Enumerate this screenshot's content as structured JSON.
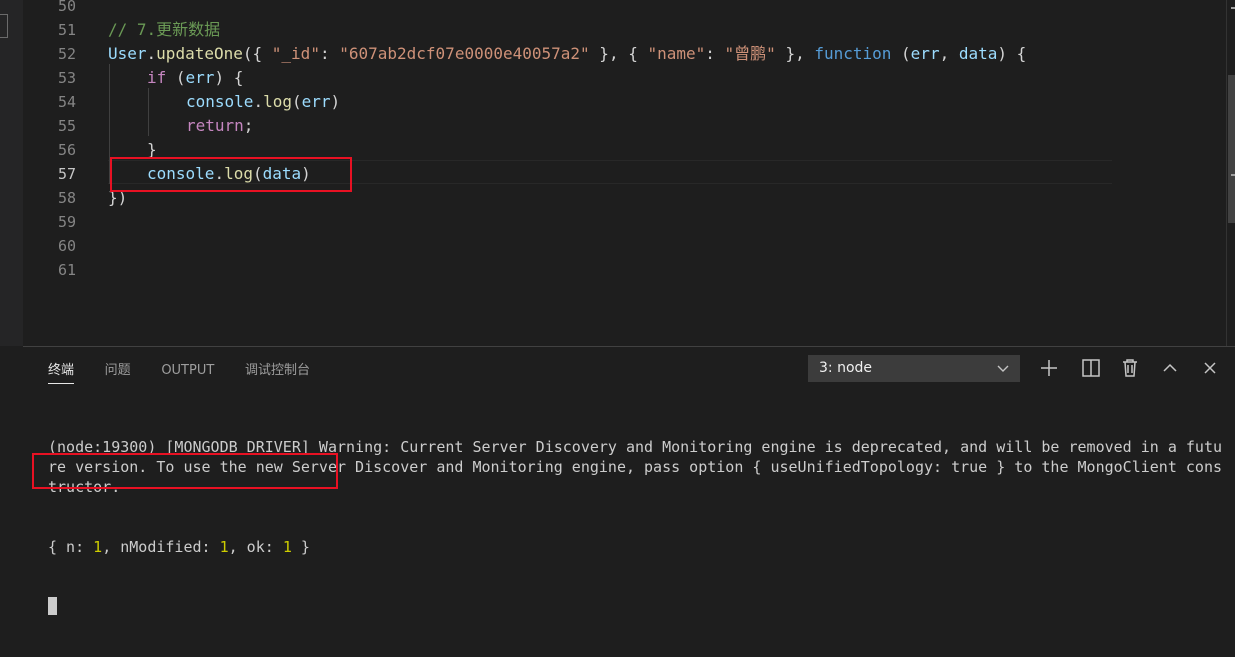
{
  "editor": {
    "lines": [
      {
        "number": "50",
        "tokens": []
      },
      {
        "number": "51",
        "indent": 0,
        "tokens": [
          {
            "t": "// 7.更新数据",
            "c": "c-com"
          }
        ]
      },
      {
        "number": "52",
        "indent": 0,
        "tokens": [
          {
            "t": "User",
            "c": "c-var"
          },
          {
            "t": ".",
            "c": "c-pun"
          },
          {
            "t": "updateOne",
            "c": "c-fn"
          },
          {
            "t": "({ ",
            "c": "c-pun"
          },
          {
            "t": "\"_id\"",
            "c": "c-str"
          },
          {
            "t": ": ",
            "c": "c-pun"
          },
          {
            "t": "\"607ab2dcf07e0000e40057a2\"",
            "c": "c-str"
          },
          {
            "t": " }, { ",
            "c": "c-pun"
          },
          {
            "t": "\"name\"",
            "c": "c-str"
          },
          {
            "t": ": ",
            "c": "c-pun"
          },
          {
            "t": "\"曾鹏\"",
            "c": "c-str"
          },
          {
            "t": " }, ",
            "c": "c-pun"
          },
          {
            "t": "function",
            "c": "c-kw"
          },
          {
            "t": " (",
            "c": "c-pun"
          },
          {
            "t": "err",
            "c": "c-var"
          },
          {
            "t": ", ",
            "c": "c-pun"
          },
          {
            "t": "data",
            "c": "c-var"
          },
          {
            "t": ") {",
            "c": "c-pun"
          }
        ]
      },
      {
        "number": "53",
        "indent": 1,
        "tokens": [
          {
            "t": "if",
            "c": "c-ctl"
          },
          {
            "t": " (",
            "c": "c-pun"
          },
          {
            "t": "err",
            "c": "c-var"
          },
          {
            "t": ") {",
            "c": "c-pun"
          }
        ]
      },
      {
        "number": "54",
        "indent": 2,
        "tokens": [
          {
            "t": "console",
            "c": "c-var"
          },
          {
            "t": ".",
            "c": "c-pun"
          },
          {
            "t": "log",
            "c": "c-fn"
          },
          {
            "t": "(",
            "c": "c-pun"
          },
          {
            "t": "err",
            "c": "c-var"
          },
          {
            "t": ")",
            "c": "c-pun"
          }
        ]
      },
      {
        "number": "55",
        "indent": 2,
        "tokens": [
          {
            "t": "return",
            "c": "c-ctl"
          },
          {
            "t": ";",
            "c": "c-pun"
          }
        ]
      },
      {
        "number": "56",
        "indent": 1,
        "tokens": [
          {
            "t": "}",
            "c": "c-pun"
          }
        ]
      },
      {
        "number": "57",
        "indent": 1,
        "active": true,
        "tokens": [
          {
            "t": "console",
            "c": "c-var"
          },
          {
            "t": ".",
            "c": "c-pun"
          },
          {
            "t": "log",
            "c": "c-fn"
          },
          {
            "t": "(",
            "c": "c-pun"
          },
          {
            "t": "data",
            "c": "c-var"
          },
          {
            "t": ")",
            "c": "c-pun"
          }
        ]
      },
      {
        "number": "58",
        "indent": 0,
        "tokens": [
          {
            "t": "})",
            "c": "c-pun"
          }
        ]
      },
      {
        "number": "59",
        "tokens": []
      },
      {
        "number": "60",
        "tokens": []
      },
      {
        "number": "61",
        "tokens": []
      }
    ]
  },
  "panel": {
    "tabs": [
      "终端",
      "问题",
      "OUTPUT",
      "调试控制台"
    ],
    "active_tab": "终端",
    "terminal_select": "3: node",
    "actions": [
      "plus-icon",
      "split-icon",
      "trash-icon",
      "chevron-up-icon",
      "close-icon"
    ],
    "output": {
      "warning": "(node:19300) [MONGODB DRIVER] Warning: Current Server Discovery and Monitoring engine is deprecated, and will be removed in a future version. To use the new Server Discover and Monitoring engine, pass option { useUnifiedTopology: true } to the MongoClient constructor.",
      "result": {
        "n": "1",
        "nModified": "1",
        "ok": "1"
      }
    }
  },
  "colors": {
    "highlight_box": "#e81123",
    "number": "#cdcd00",
    "background": "#1e1e1e"
  }
}
